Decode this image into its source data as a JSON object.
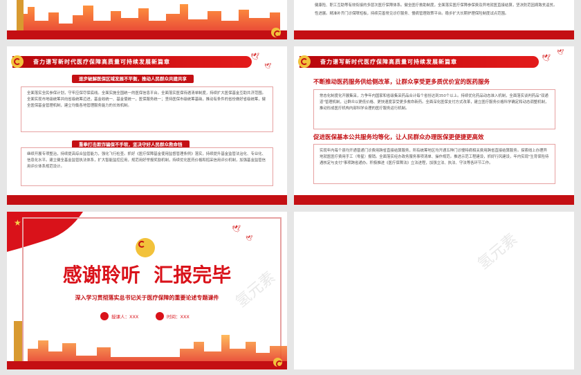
{
  "slide2_top": {
    "line1": "健康险、职工互助等有效衔接的多层次医疗保障体系。健全医疗救助制度，全面落实医疗保障参保费及异地就医直接结算，坚决防范因病致贫返贫。",
    "line2": "性进展。精准补齐门诊保障短板，持续完善常见诊疗服务、慢病管理政策平台。稳步扩大长期护理保险制度试点范围。"
  },
  "banner_title": "奋力谱写新时代医疗保障高质量可持续发展新篇章",
  "slide3": {
    "pill1": "逐步破解医保区域发展不平衡，推动人民群众共建共享",
    "box1": "全面落实全民参保计划，守牢应保尽保底线。全面实施全国统一的医保信息平台。全面落实医保待遇清单制度，持续扩大医保基金互助共济范围。全面实现市地级统筹并向省级统筹迈进，基金收统一、基金使统一，医保服务统一；坚持医保市级统筹基础，推动有条件的省份做好省级统筹，健全医保基金管理机制，建立均衡各地管理服务能力的长效机制。",
    "pill2": "重拳打击欺诈骗保不手软，坚决守好人民群众救命钱",
    "box2": "继续开展专项整治，持续提高综合监管能力，强化飞行检查。抓好《医疗保障基金使用监督管理条例》落实，持续提升基金监管法治化、专业化、信息化水平。建立健全基金监管执法体系，扩大智能监控应用，规范用好举报奖励机制，持续优化医药价格和招采信用评价机制，加强基金监管信用评价体系规范设计。"
  },
  "slide4": {
    "heading1": "不断推动医药服务供给侧改革，让群众享受更多质优价宜的医药服务",
    "box1": "常态化制度化开展集采，力争年内国家和省级集采药品合计每个省份达到350个以上。持续优化药品动态准入机制，全面落实谈判药品\"双通道\"管理机制，让群众以更低价格、更快速度享受更多救命新药。全面深化医保支付方式改革，建立医疗服务价格科学确定和动态调整机制，推动形成医疗机构内部科学合理的医疗服务运行机制。",
    "heading2": "促进医保基本公共服务均等化，让人民群众办理医保更便捷更高效",
    "box2": "实现年内每个县均开通普通门诊费用跨省直接结算服务，所有统筹地区均开通五种门诊慢特病相关费用跨省直接结算服务。探索线上办理异地就医医疗费用手工（零星）报销。全面落实经办政务服务事项清单、操作规范。推进示范工程建设，抓好行风建设，年内实现\"生育保险待遇核定与支付\"事项跨省通办。积极推进《医疗保障法》立法进程，加强立法、执法、守法等各环节工作。"
  },
  "slide5": {
    "main_title": "感谢聆听  汇报完毕",
    "subtitle": "深入学习贯彻落实总书记关于医疗保障的重要论述专题课件",
    "presenter": "授课人：XXX",
    "time": "时间：XXX"
  },
  "watermark": "氢元素",
  "colors": {
    "red": "#c40f13",
    "gold": "#f2c23b"
  }
}
